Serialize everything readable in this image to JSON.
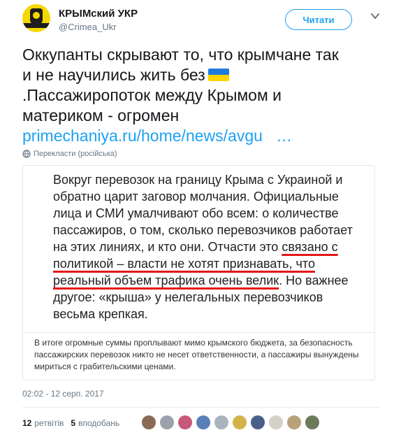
{
  "header": {
    "name": "КРЫМский УКР",
    "handle": "@Crimea_Ukr",
    "follow_label": "Читати"
  },
  "tweet": {
    "line1": "Оккупанты скрывают то, что крымчане так",
    "line2": "и не научились жить без",
    "line3": ".Пассажиропоток между Крымом и",
    "line4": "материком - огромен",
    "link": "primechaniya.ru/home/news/avgu   …",
    "translate_label": "Перекласти (російська)"
  },
  "card": {
    "quote_p1": "Вокруг перевозок на границу Крыма с Украиной и обратно царит заговор молчания. Официальные лица и СМИ умалчивают обо всем: о количестве пассажиров, о том, сколько перевозчиков работает на этих линиях, и кто они. Отчасти это ",
    "quote_underlined": "связано с политикой – власти не хотят признавать, что реальный объем трафика очень велик",
    "quote_p2": ". Но важнее другое: «крыша» у нелегальных перевозчиков весьма крепкая.",
    "summary": "В итоге огромные суммы проплывают мимо крымского бюджета, за безопасность пассажирских перевозок никто не несет ответственности, а пассажиры вынуждены мириться с грабительскими ценами."
  },
  "meta": {
    "timestamp": "02:02 - 12 серп. 2017",
    "retweets_count": "12",
    "retweets_label": "ретвітів",
    "likes_count": "5",
    "likes_label": "вподобань"
  },
  "colors": {
    "accent": "#1da1f2",
    "underline": "#e2171c",
    "flag_blue": "#1f7ae0",
    "flag_yellow": "#ffd400"
  },
  "likers": [
    {
      "icon": "avatar-1",
      "color": "#8a6a55"
    },
    {
      "icon": "avatar-2",
      "color": "#9aa3ab"
    },
    {
      "icon": "avatar-3",
      "color": "#c9577a"
    },
    {
      "icon": "avatar-4",
      "color": "#5a7fb8"
    },
    {
      "icon": "avatar-5",
      "color": "#aab4bd"
    },
    {
      "icon": "avatar-6",
      "color": "#d4b24a"
    },
    {
      "icon": "avatar-7",
      "color": "#4a5f8a"
    },
    {
      "icon": "avatar-8",
      "color": "#d5d0c8"
    },
    {
      "icon": "avatar-9",
      "color": "#b9a27a"
    },
    {
      "icon": "avatar-10",
      "color": "#6b7b5a"
    }
  ]
}
